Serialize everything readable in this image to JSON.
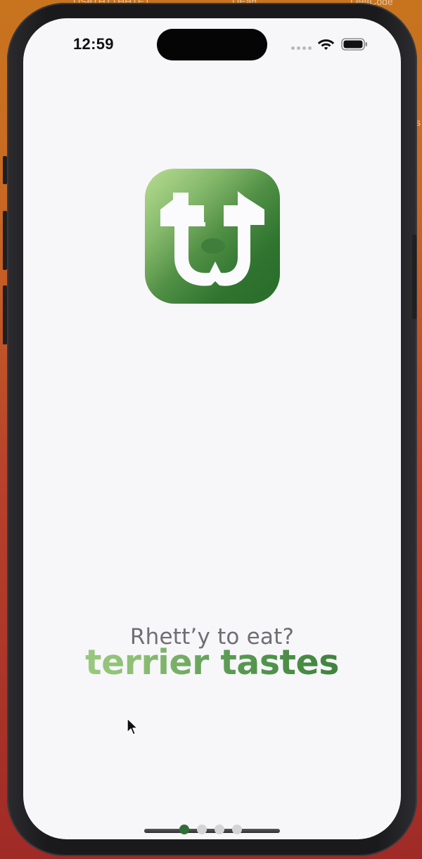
{
  "desktop": {
    "labels": [
      "DSeTHTTHHTET",
      "DEan",
      "LeetCode"
    ],
    "side_label": "s"
  },
  "status_bar": {
    "time": "12:59",
    "wifi_icon": "wifi-icon",
    "battery_icon": "battery-full-icon",
    "cellular_icon": "cellular-no-signal-icon"
  },
  "logo": {
    "icon": "terrier-tastes-logo-icon",
    "colors": {
      "light": "#a6d57a",
      "dark": "#2a6b2b",
      "glyph": "#ffffff"
    }
  },
  "tagline": "Rhett’y to eat?",
  "brand_name": "terrier tastes",
  "pager": {
    "count": 4,
    "active_index": 0,
    "active_color": "#2f6f35"
  },
  "cursor_icon": "mouse-pointer-icon"
}
